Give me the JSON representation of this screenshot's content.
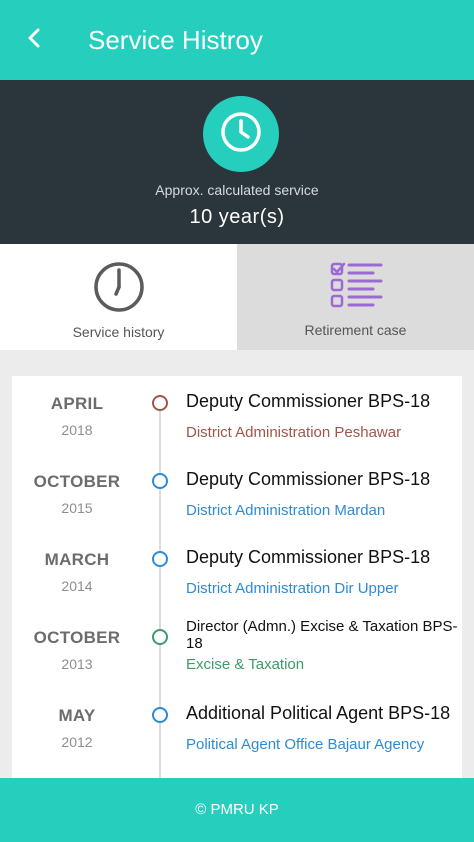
{
  "appbar": {
    "title": "Service Histroy"
  },
  "summary": {
    "label": "Approx. calculated service",
    "value": "10 year(s)"
  },
  "tabs": [
    {
      "label": "Service history",
      "icon": "clock-icon",
      "active": true
    },
    {
      "label": "Retirement case",
      "icon": "checklist-icon",
      "active": false
    }
  ],
  "timeline": [
    {
      "month": "APRIL",
      "year": "2018",
      "post": "Deputy Commissioner BPS-18",
      "org": "District Administration Peshawar",
      "color": "#a0554a"
    },
    {
      "month": "OCTOBER",
      "year": "2015",
      "post": "Deputy Commissioner BPS-18",
      "org": "District Administration Mardan",
      "color": "#2d8bd6"
    },
    {
      "month": "MARCH",
      "year": "2014",
      "post": "Deputy Commissioner BPS-18",
      "org": "District Administration Dir Upper",
      "color": "#2d8bd6"
    },
    {
      "month": "OCTOBER",
      "year": "2013",
      "post": "Director (Admn.) Excise & Taxation BPS-18",
      "org": "Excise & Taxation",
      "color": "#3e9a6a"
    },
    {
      "month": "MAY",
      "year": "2012",
      "post": "Additional Political Agent BPS-18",
      "org": "Political Agent Office Bajaur Agency",
      "color": "#2d8bd6"
    }
  ],
  "footer": {
    "text": "© PMRU KP"
  },
  "colors": {
    "accent": "#26cfbd",
    "dark": "#2b353c",
    "retirement_icon": "#9b6ad6"
  }
}
